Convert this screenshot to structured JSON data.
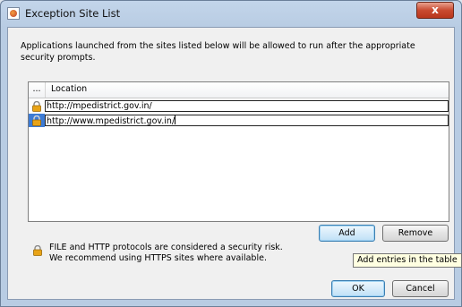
{
  "window": {
    "title": "Exception Site List",
    "close_glyph": "x",
    "title_icon": "java-icon"
  },
  "description": "Applications launched from the sites listed below will be allowed to run after the appropriate security prompts.",
  "table": {
    "columns": [
      "...",
      "Location"
    ],
    "rows": [
      {
        "location": "http://mpedistrict.gov.in/",
        "icon": "lock-icon",
        "selected": false
      },
      {
        "location": "http://www.mpedistrict.gov.in/",
        "icon": "lock-icon",
        "selected": true
      }
    ]
  },
  "buttons": {
    "add": "Add",
    "remove": "Remove",
    "ok": "OK",
    "cancel": "Cancel"
  },
  "warning": {
    "line1": "FILE and HTTP protocols are considered a security risk.",
    "line2": "We recommend using HTTPS sites where available.",
    "icon": "lock-warning-icon"
  },
  "tooltip": "Add entries in the table",
  "colors": {
    "selection": "#3d7bd4",
    "close_button": "#c94a30",
    "lock_body": "#e8a317"
  }
}
